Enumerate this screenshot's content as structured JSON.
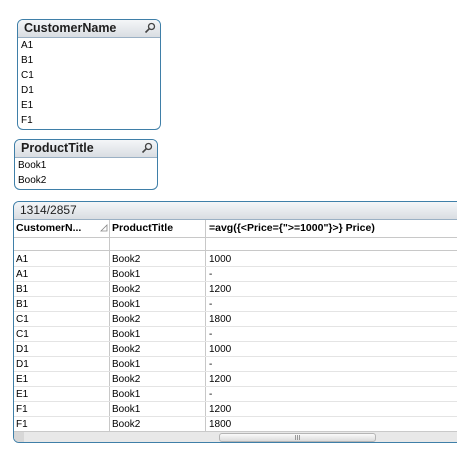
{
  "customer_listbox": {
    "title": "CustomerName",
    "items": [
      "A1",
      "B1",
      "C1",
      "D1",
      "E1",
      "F1"
    ]
  },
  "product_listbox": {
    "title": "ProductTitle",
    "items": [
      "Book1",
      "Book2"
    ]
  },
  "table": {
    "caption": "1314/2857",
    "headers": [
      "CustomerN...",
      "ProductTitle",
      "=avg({<Price={\">=1000\"}>} Price)"
    ],
    "rows": [
      [
        "A1",
        "Book2",
        "1000"
      ],
      [
        "A1",
        "Book1",
        "-"
      ],
      [
        "B1",
        "Book2",
        "1200"
      ],
      [
        "B1",
        "Book1",
        "-"
      ],
      [
        "C1",
        "Book2",
        "1800"
      ],
      [
        "C1",
        "Book1",
        "-"
      ],
      [
        "D1",
        "Book2",
        "1000"
      ],
      [
        "D1",
        "Book1",
        "-"
      ],
      [
        "E1",
        "Book2",
        "1200"
      ],
      [
        "E1",
        "Book1",
        "-"
      ],
      [
        "F1",
        "Book1",
        "1200"
      ],
      [
        "F1",
        "Book2",
        "1800"
      ]
    ]
  },
  "colors": {
    "border": "#3f7fa8",
    "caption_bg": "#d9dde2"
  }
}
